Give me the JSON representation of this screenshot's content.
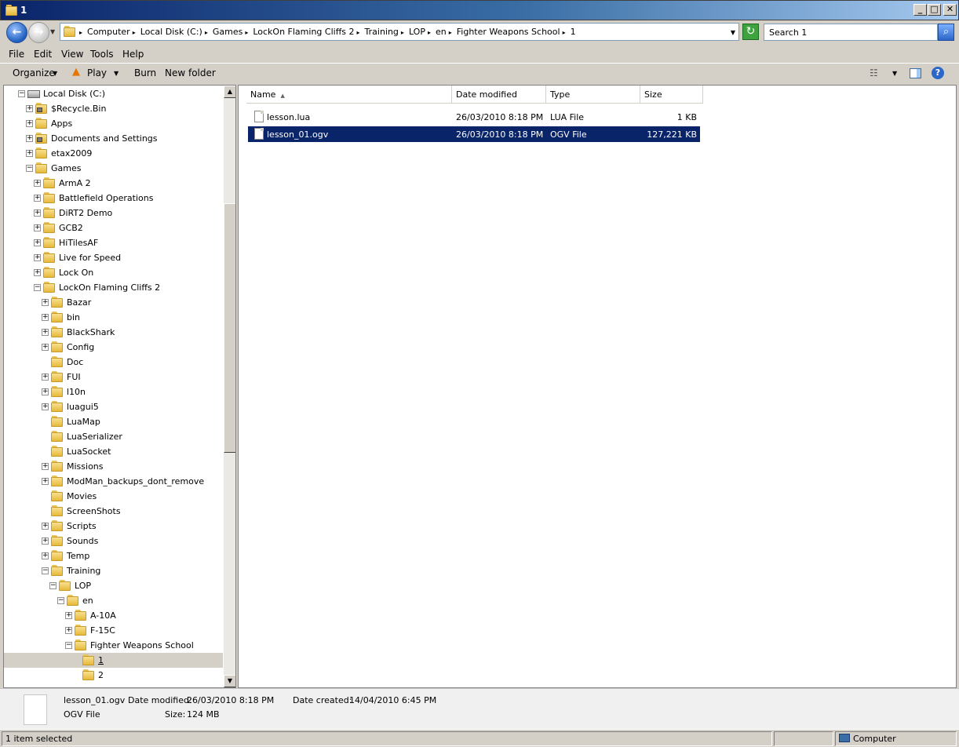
{
  "window": {
    "title": "1"
  },
  "address": {
    "crumbs": [
      "Computer",
      "Local Disk (C:)",
      "Games",
      "LockOn Flaming Cliffs 2",
      "Training",
      "LOP",
      "en",
      "Fighter Weapons School",
      "1"
    ],
    "search_placeholder": "Search 1"
  },
  "menu": {
    "file": "File",
    "edit": "Edit",
    "view": "View",
    "tools": "Tools",
    "help": "Help"
  },
  "toolbar": {
    "organize": "Organize",
    "play": "Play",
    "burn": "Burn",
    "new_folder": "New folder"
  },
  "tree": [
    {
      "label": "Local Disk (C:)",
      "level": 0,
      "exp": "minus",
      "icon": "drive"
    },
    {
      "label": "$Recycle.Bin",
      "level": 1,
      "exp": "plus",
      "icon": "locked-folder"
    },
    {
      "label": "Apps",
      "level": 1,
      "exp": "plus",
      "icon": "folder"
    },
    {
      "label": "Documents and Settings",
      "level": 1,
      "exp": "plus",
      "icon": "locked-folder"
    },
    {
      "label": "etax2009",
      "level": 1,
      "exp": "plus",
      "icon": "folder"
    },
    {
      "label": "Games",
      "level": 1,
      "exp": "minus",
      "icon": "folder"
    },
    {
      "label": "ArmA 2",
      "level": 2,
      "exp": "plus",
      "icon": "folder"
    },
    {
      "label": "Battlefield Operations",
      "level": 2,
      "exp": "plus",
      "icon": "folder"
    },
    {
      "label": "DiRT2 Demo",
      "level": 2,
      "exp": "plus",
      "icon": "folder"
    },
    {
      "label": "GCB2",
      "level": 2,
      "exp": "plus",
      "icon": "folder"
    },
    {
      "label": "HiTilesAF",
      "level": 2,
      "exp": "plus",
      "icon": "folder"
    },
    {
      "label": "Live for Speed",
      "level": 2,
      "exp": "plus",
      "icon": "folder"
    },
    {
      "label": "Lock On",
      "level": 2,
      "exp": "plus",
      "icon": "folder"
    },
    {
      "label": "LockOn Flaming Cliffs 2",
      "level": 2,
      "exp": "minus",
      "icon": "folder"
    },
    {
      "label": "Bazar",
      "level": 3,
      "exp": "plus",
      "icon": "folder"
    },
    {
      "label": "bin",
      "level": 3,
      "exp": "plus",
      "icon": "folder"
    },
    {
      "label": "BlackShark",
      "level": 3,
      "exp": "plus",
      "icon": "folder"
    },
    {
      "label": "Config",
      "level": 3,
      "exp": "plus",
      "icon": "folder"
    },
    {
      "label": "Doc",
      "level": 3,
      "exp": "none",
      "icon": "folder"
    },
    {
      "label": "FUI",
      "level": 3,
      "exp": "plus",
      "icon": "folder"
    },
    {
      "label": "l10n",
      "level": 3,
      "exp": "plus",
      "icon": "folder"
    },
    {
      "label": "luagui5",
      "level": 3,
      "exp": "plus",
      "icon": "folder"
    },
    {
      "label": "LuaMap",
      "level": 3,
      "exp": "none",
      "icon": "folder"
    },
    {
      "label": "LuaSerializer",
      "level": 3,
      "exp": "none",
      "icon": "folder"
    },
    {
      "label": "LuaSocket",
      "level": 3,
      "exp": "none",
      "icon": "folder"
    },
    {
      "label": "Missions",
      "level": 3,
      "exp": "plus",
      "icon": "folder"
    },
    {
      "label": "ModMan_backups_dont_remove",
      "level": 3,
      "exp": "plus",
      "icon": "folder"
    },
    {
      "label": "Movies",
      "level": 3,
      "exp": "none",
      "icon": "folder"
    },
    {
      "label": "ScreenShots",
      "level": 3,
      "exp": "none",
      "icon": "folder"
    },
    {
      "label": "Scripts",
      "level": 3,
      "exp": "plus",
      "icon": "folder"
    },
    {
      "label": "Sounds",
      "level": 3,
      "exp": "plus",
      "icon": "folder"
    },
    {
      "label": "Temp",
      "level": 3,
      "exp": "plus",
      "icon": "folder"
    },
    {
      "label": "Training",
      "level": 3,
      "exp": "minus",
      "icon": "folder"
    },
    {
      "label": "LOP",
      "level": 4,
      "exp": "minus",
      "icon": "folder"
    },
    {
      "label": "en",
      "level": 5,
      "exp": "minus",
      "icon": "folder"
    },
    {
      "label": "A-10A",
      "level": 6,
      "exp": "plus",
      "icon": "folder"
    },
    {
      "label": "F-15C",
      "level": 6,
      "exp": "plus",
      "icon": "folder"
    },
    {
      "label": "Fighter Weapons School",
      "level": 6,
      "exp": "minus",
      "icon": "folder"
    },
    {
      "label": "1",
      "level": 7,
      "exp": "none",
      "icon": "folder",
      "selected": true
    },
    {
      "label": "2",
      "level": 7,
      "exp": "none",
      "icon": "folder"
    }
  ],
  "columns": {
    "name": "Name",
    "date": "Date modified",
    "type": "Type",
    "size": "Size"
  },
  "files": [
    {
      "name": "lesson.lua",
      "date": "26/03/2010 8:18 PM",
      "type": "LUA File",
      "size": "1 KB",
      "selected": false
    },
    {
      "name": "lesson_01.ogv",
      "date": "26/03/2010 8:18 PM",
      "type": "OGV File",
      "size": "127,221 KB",
      "selected": true
    }
  ],
  "details": {
    "filename": "lesson_01.ogv",
    "date_modified_label": "Date modified:",
    "date_modified": "26/03/2010 8:18 PM",
    "date_created_label": "Date created:",
    "date_created": "14/04/2010 6:45 PM",
    "filetype": "OGV File",
    "size_label": "Size:",
    "size": "124 MB"
  },
  "status": {
    "selection": "1 item selected",
    "location": "Computer"
  }
}
